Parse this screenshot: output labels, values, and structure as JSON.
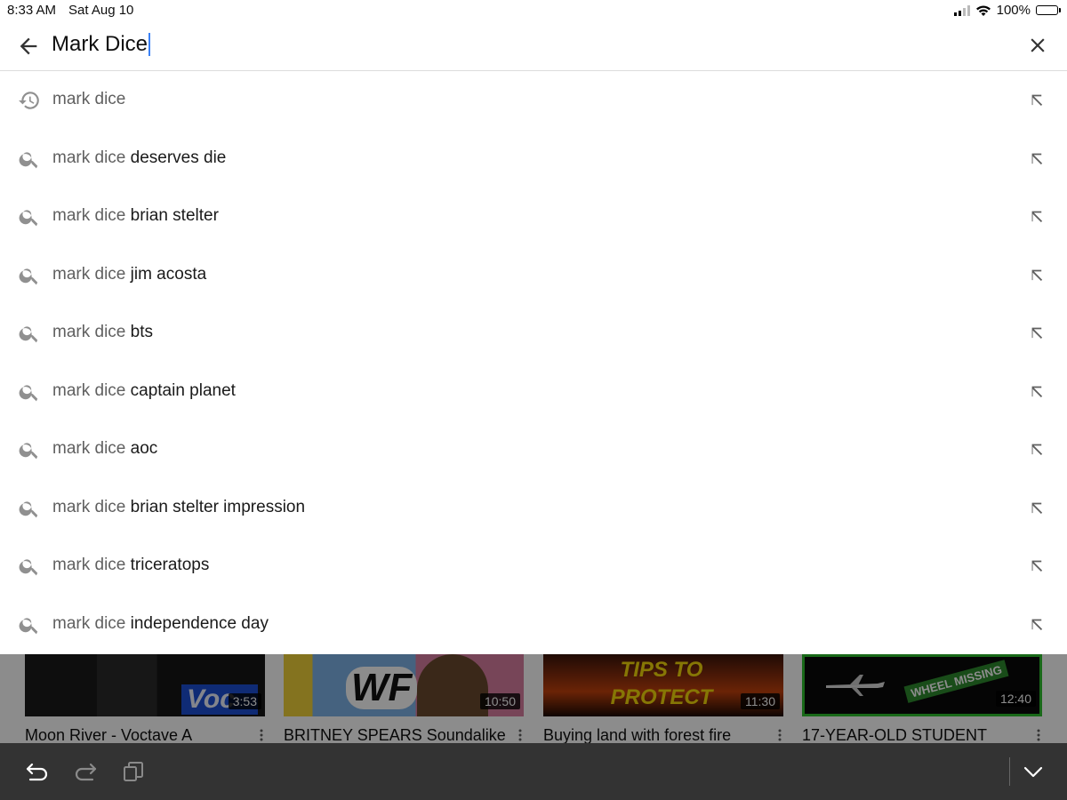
{
  "status_bar": {
    "time": "8:33 AM",
    "date": "Sat Aug 10",
    "battery": "100%"
  },
  "search": {
    "query": "Mark Dice"
  },
  "suggestions": [
    {
      "icon": "history-icon",
      "base": "mark dice",
      "rest": ""
    },
    {
      "icon": "search-icon",
      "base": "mark dice",
      "rest": " deserves die"
    },
    {
      "icon": "search-icon",
      "base": "mark dice",
      "rest": " brian stelter"
    },
    {
      "icon": "search-icon",
      "base": "mark dice",
      "rest": " jim acosta"
    },
    {
      "icon": "search-icon",
      "base": "mark dice",
      "rest": " bts"
    },
    {
      "icon": "search-icon",
      "base": "mark dice",
      "rest": " captain planet"
    },
    {
      "icon": "search-icon",
      "base": "mark dice",
      "rest": " aoc"
    },
    {
      "icon": "search-icon",
      "base": "mark dice",
      "rest": " brian stelter impression"
    },
    {
      "icon": "search-icon",
      "base": "mark dice",
      "rest": " triceratops"
    },
    {
      "icon": "search-icon",
      "base": "mark dice",
      "rest": " independence day"
    }
  ],
  "videos": [
    {
      "title": "Moon River - Voctave A",
      "duration": "3:53",
      "thumb_text": "Voc"
    },
    {
      "title": "BRITNEY SPEARS Soundalike",
      "duration": "10:50",
      "thumb_text": "WF"
    },
    {
      "title": "Buying land with forest fire",
      "duration": "11:30",
      "thumb_text": "TIPS TO PROTECT YOUR LAND"
    },
    {
      "title": "17-YEAR-OLD STUDENT",
      "duration": "12:40",
      "thumb_text": "WHEEL MISSING"
    }
  ],
  "colors": {
    "accent_caret": "#3b82f6",
    "muted_text": "#606060",
    "toolbar_bg": "#333333"
  }
}
